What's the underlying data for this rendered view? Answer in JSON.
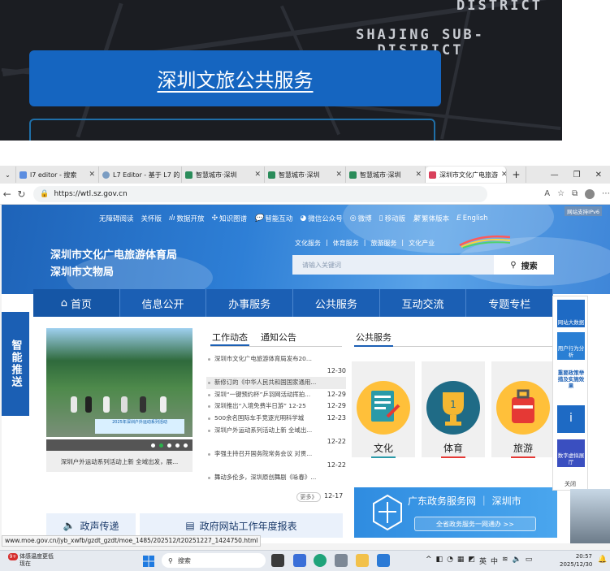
{
  "top_banner": {
    "district_top": "DISTRICT",
    "district_label": "SHAJING SUB-\nDISTRICT",
    "main_button": "深圳文旅公共服务"
  },
  "browser": {
    "tabs": [
      {
        "label": "l7 editor - 搜索"
      },
      {
        "label": "L7 Editor - 基于 L7 的"
      },
      {
        "label": "智慧城市·深圳"
      },
      {
        "label": "智慧城市·深圳"
      },
      {
        "label": "智慧城市·深圳"
      },
      {
        "label": "深圳市文化广电旅游"
      }
    ],
    "new_tab": "+",
    "url": "https://wtl.sz.gov.cn",
    "status_url": "www.moe.gov.cn/jyb_xwfb/gzdt_gzdt/moe_1485/202512/t20251227_1424750.html"
  },
  "site": {
    "ipv6": "网站支持IPv6",
    "top_links": [
      "无障碍阅读",
      "关怀版",
      "数据开放",
      "知识图谱",
      "智能互动",
      "微信公众号",
      "微博",
      "移动版",
      "繁体版本",
      "English"
    ],
    "org_name_1": "深圳市文化广电旅游体育局",
    "org_name_2": "深圳市文物局",
    "cat_links": [
      "文化服务",
      "|",
      "体育服务",
      "|",
      "旅游服务",
      "|",
      "文化产业"
    ],
    "search_placeholder": "请输入关键词",
    "search_button": "搜索",
    "menu": [
      "首页",
      "信息公开",
      "办事服务",
      "公共服务",
      "互动交流",
      "专题专栏"
    ],
    "side_ribbon": "智能推送",
    "slide_caption": "深圳户外运动系列活动上新 全域出发，展...",
    "slide_banner": "2025年深圳户外运动系列活动",
    "news_tabs": [
      "工作动态",
      "通知公告"
    ],
    "news": [
      {
        "title": "深圳市文化广电旅游体育局发布20...",
        "date": ""
      },
      {
        "title": "",
        "date": "12-30"
      },
      {
        "title": "新修订的《中华人民共和国国家通用...",
        "date": ""
      },
      {
        "title": "深圳“一键预约杯”乒羽网活动挥拍...",
        "date": "12-29"
      },
      {
        "title": "深圳推出“入境免费半日游” 12-25",
        "date": "12-29"
      },
      {
        "title": "500余名国际车手竞逐光明科学城",
        "date": "12-23"
      },
      {
        "title": "深圳户外运动系列活动上新 全域出...",
        "date": ""
      },
      {
        "title": "",
        "date": "12-22"
      },
      {
        "title": "李强主持召开国务院常务会议 对贯...",
        "date": ""
      },
      {
        "title": "",
        "date": "12-22"
      },
      {
        "title": "舞动多伦多，深圳原创舞剧《咏春》...",
        "date": ""
      }
    ],
    "more": "更多》",
    "more_date": "12-17",
    "public_service_title": "公共服务",
    "cards": [
      {
        "label": "文化",
        "color": "#2a9aa8"
      },
      {
        "label": "体育",
        "color": "#1f6b86"
      },
      {
        "label": "旅游",
        "color": "#e4433c"
      }
    ],
    "gd_banner_title": "广东政务服务网 ｜ 深圳市",
    "gd_banner_button": "全省政务服务一网通办 >>",
    "bottom_tabs": [
      "政声传递",
      "政府网站工作年度报表"
    ],
    "floater_items": [
      "网站大数据",
      "用户行为分析",
      "重要政策举措及实施效果",
      "i",
      "数字虚拟展厅"
    ],
    "floater_close": "关闭"
  },
  "taskbar": {
    "weather_badge": "9+",
    "weather_line1": "体感温度更低",
    "weather_line2": "现在",
    "search": "搜索",
    "tray": [
      "^",
      "英",
      "中"
    ],
    "time": "20:57",
    "date": "2025/12/30"
  },
  "colors": {
    "brand_blue": "#1b5fb4",
    "accent_green": "#2bb24c"
  }
}
